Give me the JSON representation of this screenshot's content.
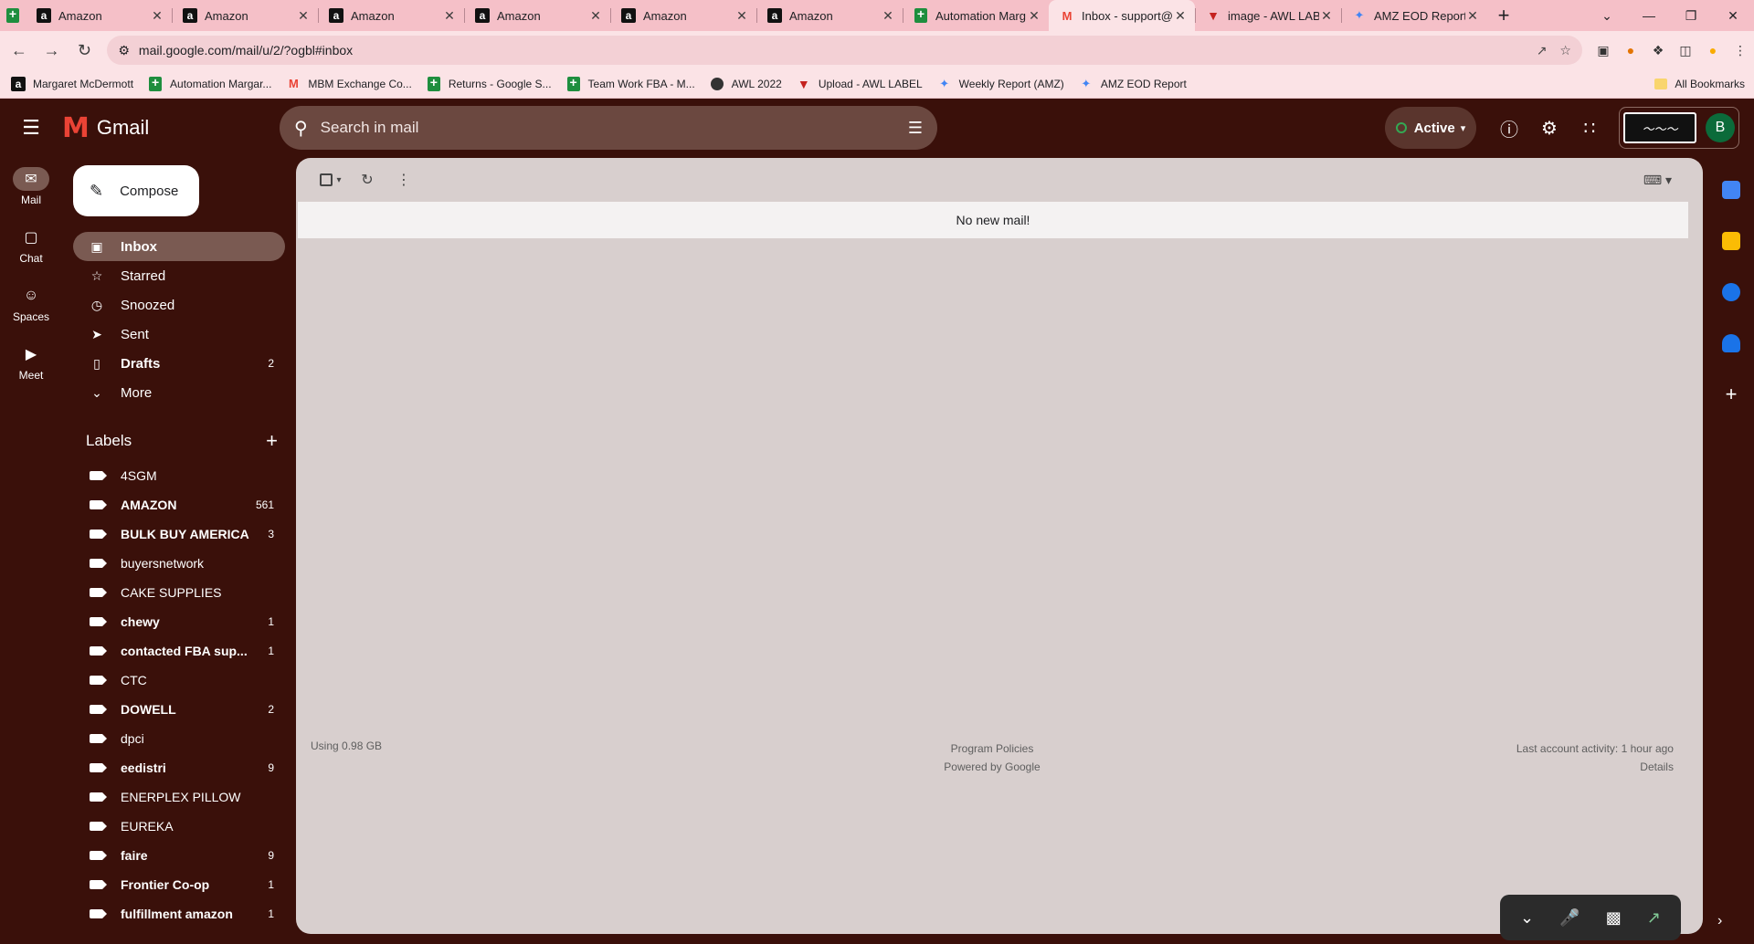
{
  "browser": {
    "tabs": [
      {
        "title": "Amazon",
        "icon": "amazon"
      },
      {
        "title": "Amazon",
        "icon": "amazon"
      },
      {
        "title": "Amazon",
        "icon": "amazon"
      },
      {
        "title": "Amazon",
        "icon": "amazon"
      },
      {
        "title": "Amazon",
        "icon": "amazon"
      },
      {
        "title": "Amazon",
        "icon": "amazon"
      },
      {
        "title": "Automation Marg",
        "icon": "sheets"
      },
      {
        "title": "Inbox - support@",
        "icon": "gmail",
        "active": true
      },
      {
        "title": "image - AWL LABE",
        "icon": "awl"
      },
      {
        "title": "AMZ EOD Report",
        "icon": "amz"
      }
    ],
    "url": "mail.google.com/mail/u/2/?ogbl#inbox",
    "bookmarks": [
      {
        "title": "Margaret McDermott",
        "icon": "amazon"
      },
      {
        "title": "Automation Margar...",
        "icon": "sheets"
      },
      {
        "title": "MBM Exchange Co...",
        "icon": "gmail"
      },
      {
        "title": "Returns - Google S...",
        "icon": "sheets"
      },
      {
        "title": "Team Work FBA - M...",
        "icon": "sheets"
      },
      {
        "title": "AWL 2022",
        "icon": "globe"
      },
      {
        "title": "Upload - AWL LABEL",
        "icon": "awl"
      },
      {
        "title": "Weekly Report (AMZ)",
        "icon": "amz"
      },
      {
        "title": "AMZ EOD Report",
        "icon": "amz"
      }
    ],
    "all_bookmarks": "All Bookmarks"
  },
  "gmail": {
    "logo_text": "Gmail",
    "search_placeholder": "Search in mail",
    "status": "Active",
    "avatar_letter": "B",
    "rail": [
      {
        "label": "Mail",
        "icon": "mail-icon",
        "selected": true
      },
      {
        "label": "Chat",
        "icon": "chat-icon"
      },
      {
        "label": "Spaces",
        "icon": "spaces-icon"
      },
      {
        "label": "Meet",
        "icon": "meet-icon"
      }
    ],
    "compose": "Compose",
    "nav": [
      {
        "label": "Inbox",
        "icon": "inbox-icon",
        "count": "",
        "selected": true,
        "bold": true
      },
      {
        "label": "Starred",
        "icon": "star-icon",
        "count": ""
      },
      {
        "label": "Snoozed",
        "icon": "clock-icon",
        "count": ""
      },
      {
        "label": "Sent",
        "icon": "send-icon",
        "count": ""
      },
      {
        "label": "Drafts",
        "icon": "draft-icon",
        "count": "2",
        "bold": true
      },
      {
        "label": "More",
        "icon": "chevron-down-icon",
        "count": ""
      }
    ],
    "labels_title": "Labels",
    "labels": [
      {
        "name": "4SGM",
        "count": "",
        "bold": false
      },
      {
        "name": "AMAZON",
        "count": "561",
        "bold": true
      },
      {
        "name": "BULK BUY AMERICA",
        "count": "3",
        "bold": true
      },
      {
        "name": "buyersnetwork",
        "count": "",
        "bold": false
      },
      {
        "name": "CAKE SUPPLIES",
        "count": "",
        "bold": false
      },
      {
        "name": "chewy",
        "count": "1",
        "bold": true
      },
      {
        "name": "contacted FBA sup...",
        "count": "1",
        "bold": true
      },
      {
        "name": "CTC",
        "count": "",
        "bold": false
      },
      {
        "name": "DOWELL",
        "count": "2",
        "bold": true
      },
      {
        "name": "dpci",
        "count": "",
        "bold": false
      },
      {
        "name": "eedistri",
        "count": "9",
        "bold": true
      },
      {
        "name": "ENERPLEX PILLOW",
        "count": "",
        "bold": false
      },
      {
        "name": "EUREKA",
        "count": "",
        "bold": false
      },
      {
        "name": "faire",
        "count": "9",
        "bold": true
      },
      {
        "name": "Frontier Co-op",
        "count": "1",
        "bold": true
      },
      {
        "name": "fulfillment amazon",
        "count": "1",
        "bold": true
      }
    ],
    "empty_message": "No new mail!",
    "footer": {
      "storage": "Using 0.98 GB",
      "policies": "Program Policies",
      "powered": "Powered by Google",
      "activity": "Last account activity: 1 hour ago",
      "details": "Details"
    }
  }
}
